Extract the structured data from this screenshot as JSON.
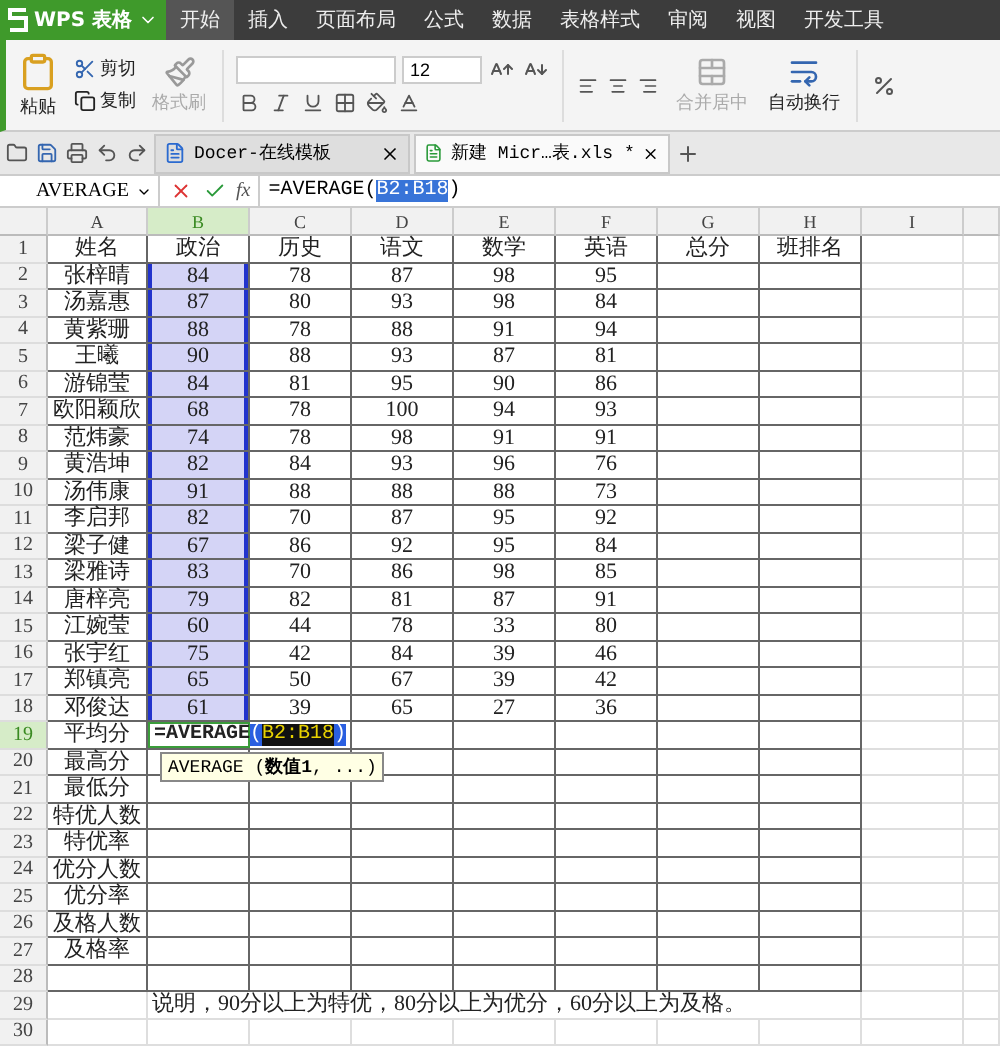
{
  "app": {
    "title": "WPS 表格"
  },
  "menu_tabs": [
    {
      "label": "开始",
      "selected": true
    },
    {
      "label": "插入",
      "selected": false
    },
    {
      "label": "页面布局",
      "selected": false
    },
    {
      "label": "公式",
      "selected": false
    },
    {
      "label": "数据",
      "selected": false
    },
    {
      "label": "表格样式",
      "selected": false
    },
    {
      "label": "审阅",
      "selected": false
    },
    {
      "label": "视图",
      "selected": false
    },
    {
      "label": "开发工具",
      "selected": false
    }
  ],
  "ribbon": {
    "paste": "粘贴",
    "cut": "剪切",
    "copy": "复制",
    "format_painter": {
      "label": "格式刷",
      "disabled": true
    },
    "font_size": "12",
    "merge": {
      "label": "合并居中",
      "disabled": true
    },
    "wrap": {
      "label": "自动换行",
      "disabled": false
    }
  },
  "doc_tabs": [
    {
      "title": "Docer-在线模板",
      "selected": false,
      "kind": "docer"
    },
    {
      "title": "新建 Micr…表.xls *",
      "selected": true,
      "kind": "sheet"
    }
  ],
  "formula_bar": {
    "name_box": "AVERAGE",
    "fx_label": "fx",
    "prefix": "=AVERAGE(",
    "reference": "B2:B18",
    "suffix": ")"
  },
  "columns": [
    {
      "label": "A",
      "selected": false
    },
    {
      "label": "B",
      "selected": true
    },
    {
      "label": "C",
      "selected": false
    },
    {
      "label": "D",
      "selected": false
    },
    {
      "label": "E",
      "selected": false
    },
    {
      "label": "F",
      "selected": false
    },
    {
      "label": "G",
      "selected": false
    },
    {
      "label": "H",
      "selected": false
    },
    {
      "label": "I",
      "selected": false
    }
  ],
  "rows": [
    {
      "num": "1",
      "kind": "data",
      "selected": false,
      "in_range": false,
      "cells": [
        "姓名",
        "政治",
        "历史",
        "语文",
        "数学",
        "英语",
        "总分",
        "班排名"
      ]
    },
    {
      "num": "2",
      "kind": "data",
      "selected": false,
      "in_range": true,
      "cells": [
        "张梓晴",
        "84",
        "78",
        "87",
        "98",
        "95"
      ]
    },
    {
      "num": "3",
      "kind": "data",
      "selected": false,
      "in_range": true,
      "cells": [
        "汤嘉惠",
        "87",
        "80",
        "93",
        "98",
        "84"
      ]
    },
    {
      "num": "4",
      "kind": "data",
      "selected": false,
      "in_range": true,
      "cells": [
        "黄紫珊",
        "88",
        "78",
        "88",
        "91",
        "94"
      ]
    },
    {
      "num": "5",
      "kind": "data",
      "selected": false,
      "in_range": true,
      "cells": [
        "王曦",
        "90",
        "88",
        "93",
        "87",
        "81"
      ]
    },
    {
      "num": "6",
      "kind": "data",
      "selected": false,
      "in_range": true,
      "cells": [
        "游锦莹",
        "84",
        "81",
        "95",
        "90",
        "86"
      ]
    },
    {
      "num": "7",
      "kind": "data",
      "selected": false,
      "in_range": true,
      "cells": [
        "欧阳颖欣",
        "68",
        "78",
        "100",
        "94",
        "93"
      ]
    },
    {
      "num": "8",
      "kind": "data",
      "selected": false,
      "in_range": true,
      "cells": [
        "范炜豪",
        "74",
        "78",
        "98",
        "91",
        "91"
      ]
    },
    {
      "num": "9",
      "kind": "data",
      "selected": false,
      "in_range": true,
      "cells": [
        "黄浩坤",
        "82",
        "84",
        "93",
        "96",
        "76"
      ]
    },
    {
      "num": "10",
      "kind": "data",
      "selected": false,
      "in_range": true,
      "cells": [
        "汤伟康",
        "91",
        "88",
        "88",
        "88",
        "73"
      ]
    },
    {
      "num": "11",
      "kind": "data",
      "selected": false,
      "in_range": true,
      "cells": [
        "李启邦",
        "82",
        "70",
        "87",
        "95",
        "92"
      ]
    },
    {
      "num": "12",
      "kind": "data",
      "selected": false,
      "in_range": true,
      "cells": [
        "梁子健",
        "67",
        "86",
        "92",
        "95",
        "84"
      ]
    },
    {
      "num": "13",
      "kind": "data",
      "selected": false,
      "in_range": true,
      "cells": [
        "梁雅诗",
        "83",
        "70",
        "86",
        "98",
        "85"
      ]
    },
    {
      "num": "14",
      "kind": "data",
      "selected": false,
      "in_range": true,
      "cells": [
        "唐梓亮",
        "79",
        "82",
        "81",
        "87",
        "91"
      ]
    },
    {
      "num": "15",
      "kind": "data",
      "selected": false,
      "in_range": true,
      "cells": [
        "江婉莹",
        "60",
        "44",
        "78",
        "33",
        "80"
      ]
    },
    {
      "num": "16",
      "kind": "data",
      "selected": false,
      "in_range": true,
      "cells": [
        "张宇红",
        "75",
        "42",
        "84",
        "39",
        "46"
      ]
    },
    {
      "num": "17",
      "kind": "data",
      "selected": false,
      "in_range": true,
      "cells": [
        "郑镇亮",
        "65",
        "50",
        "67",
        "39",
        "42"
      ]
    },
    {
      "num": "18",
      "kind": "data",
      "selected": false,
      "in_range": true,
      "cells": [
        "邓俊达",
        "61",
        "39",
        "65",
        "27",
        "36"
      ]
    },
    {
      "num": "19",
      "kind": "formula",
      "selected": true,
      "in_range": false,
      "cells": [
        "平均分"
      ]
    },
    {
      "num": "20",
      "kind": "data",
      "selected": false,
      "in_range": false,
      "cells": [
        "最高分"
      ]
    },
    {
      "num": "21",
      "kind": "data",
      "selected": false,
      "in_range": false,
      "cells": [
        "最低分"
      ]
    },
    {
      "num": "22",
      "kind": "data",
      "selected": false,
      "in_range": false,
      "cells": [
        "特优人数"
      ]
    },
    {
      "num": "23",
      "kind": "data",
      "selected": false,
      "in_range": false,
      "cells": [
        "特优率"
      ]
    },
    {
      "num": "24",
      "kind": "data",
      "selected": false,
      "in_range": false,
      "cells": [
        "优分人数"
      ]
    },
    {
      "num": "25",
      "kind": "data",
      "selected": false,
      "in_range": false,
      "cells": [
        "优分率"
      ]
    },
    {
      "num": "26",
      "kind": "data",
      "selected": false,
      "in_range": false,
      "cells": [
        "及格人数"
      ]
    },
    {
      "num": "27",
      "kind": "data",
      "selected": false,
      "in_range": false,
      "cells": [
        "及格率"
      ]
    },
    {
      "num": "28",
      "kind": "data",
      "selected": false,
      "in_range": false,
      "cells": []
    },
    {
      "num": "29",
      "kind": "note",
      "selected": false,
      "in_range": false,
      "cells": [
        "说明，90分以上为特优，80分以上为优分，60分以上为及格。"
      ]
    },
    {
      "num": "30",
      "kind": "data",
      "selected": false,
      "in_range": false,
      "cells": []
    }
  ],
  "cell_formula": {
    "function": "=AVERAGE",
    "open": "(",
    "reference": "B2:B18",
    "close": ")"
  },
  "tooltip": "AVERAGE (**数值1**, ...)"
}
